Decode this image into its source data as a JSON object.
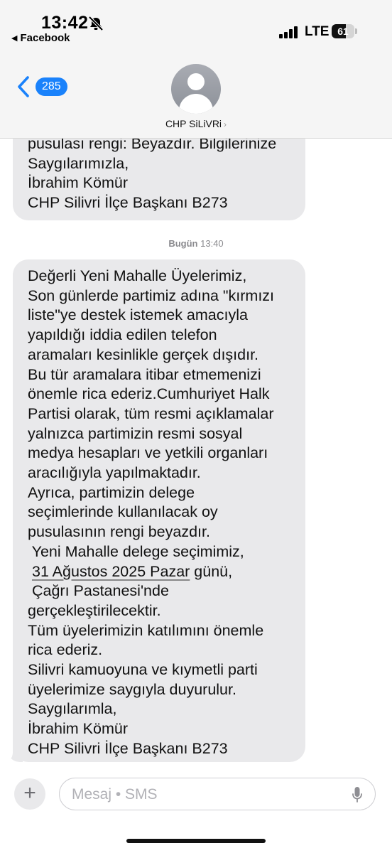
{
  "status_bar": {
    "time": "13:42",
    "back_app": "Facebook",
    "network": "LTE",
    "battery_level": "61",
    "battery_fraction": 0.61,
    "silent_icon": "bell-slash-icon"
  },
  "header": {
    "unread_count": "285",
    "contact_name": "CHP SiLiVRi",
    "contact_chevron": "›"
  },
  "messages": {
    "previous_lines": [
      "pusulası rengi: Beyazdır. Bilgilerinize",
      "Saygılarımızla,",
      "İbrahim Kömür",
      "CHP Silivri İlçe Başkanı B273"
    ],
    "timestamp_day": "Bugün",
    "timestamp_time": "13:40",
    "main_lines_a": [
      "Değerli Yeni Mahalle Üyelerimiz,",
      "Son günlerde partimiz adına \"kırmızı",
      "liste\"ye destek istemek amacıyla",
      "yapıldığı iddia edilen telefon",
      "aramaları kesinlikle gerçek dışıdır.",
      "Bu tür aramalara itibar etmemenizi",
      "önemle rica ederiz.Cumhuriyet Halk",
      "Partisi olarak, tüm resmi açıklamalar",
      "yalnızca partimizin resmi sosyal",
      "medya hesapları ve yetkili organları",
      "aracılığıyla yapılmaktadır.",
      "Ayrıca, partimizin delege",
      "seçimlerinde kullanılacak oy",
      "pusulasının rengi beyazdır.",
      " Yeni Mahalle delege seçimimiz,"
    ],
    "date_link": "31 Ağustos 2025 Pazar",
    "date_suffix": " günü,",
    "main_lines_b": [
      " Çağrı Pastanesi'nde",
      "gerçekleştirilecektir.",
      "Tüm üyelerimizin katılımını önemle",
      "rica ederiz.",
      "Silivri kamuoyuna ve kıymetli parti",
      "üyelerimize saygıyla duyurulur.",
      "Saygılarımla,",
      "İbrahim Kömür",
      "CHP Silivri İlçe Başkanı B273"
    ]
  },
  "composer": {
    "placeholder": "Mesaj • SMS",
    "plus": "+"
  }
}
